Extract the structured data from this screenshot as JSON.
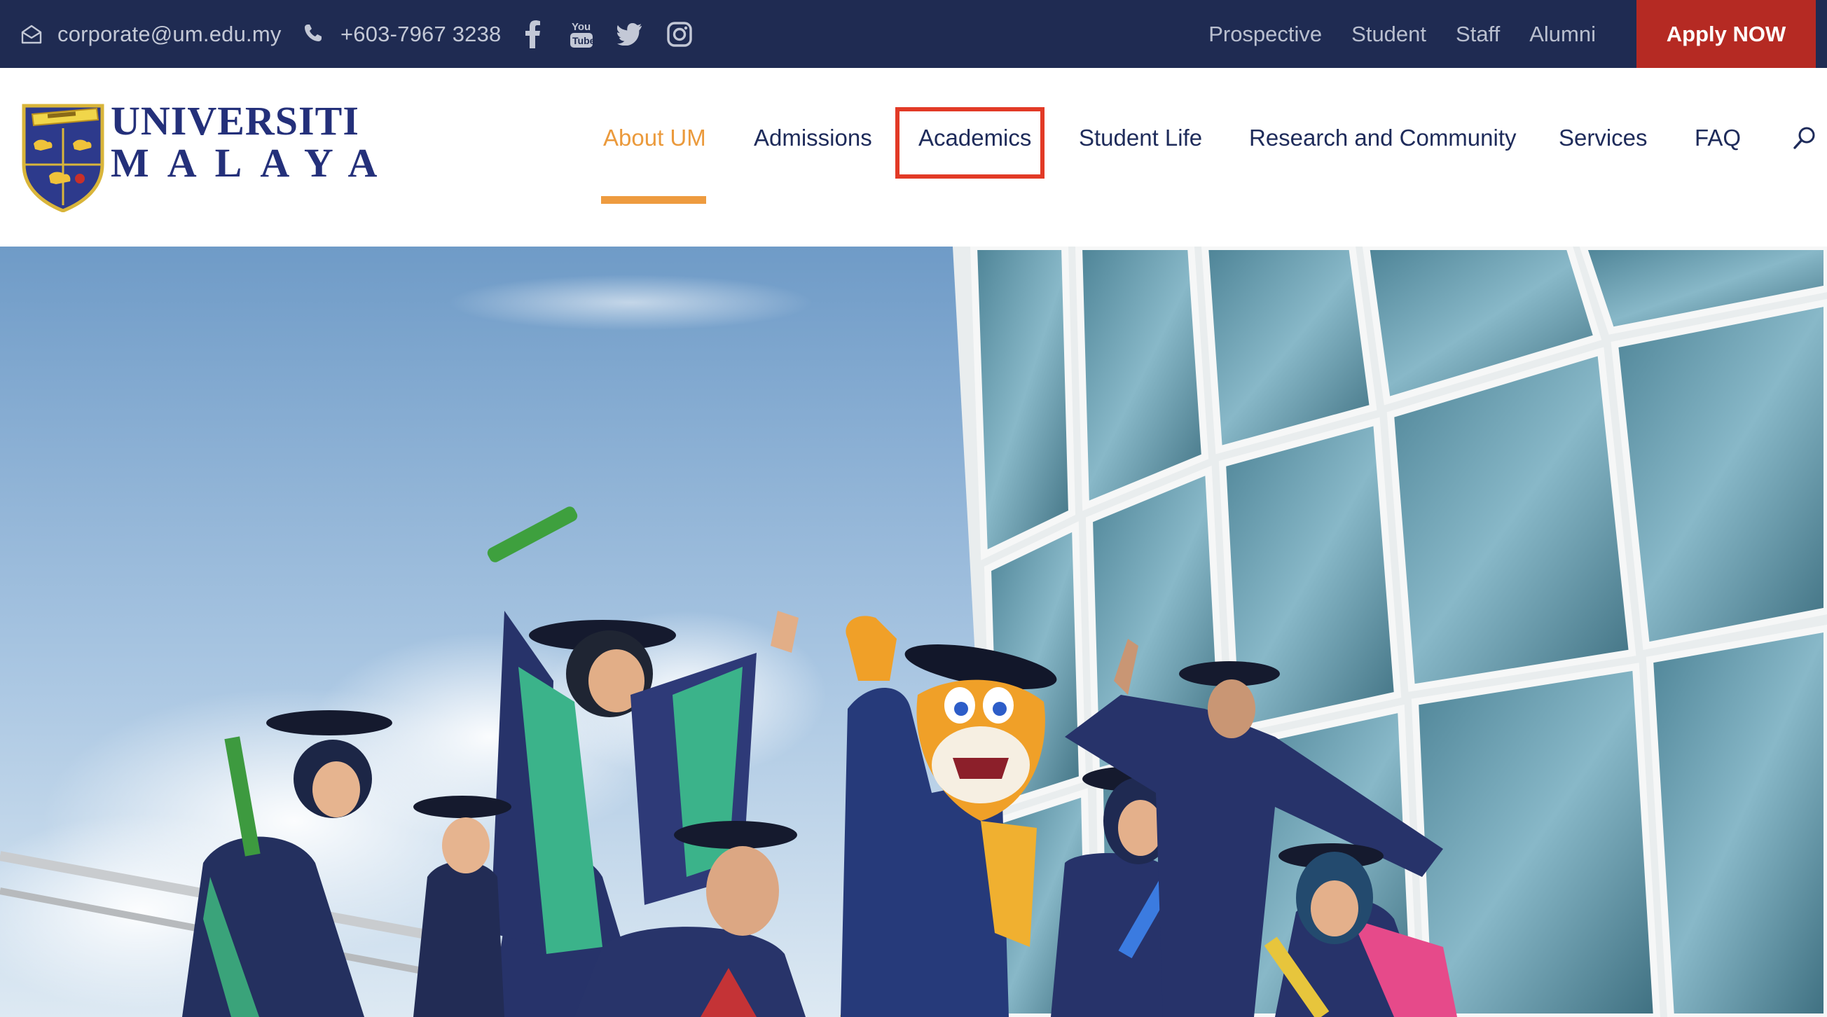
{
  "topbar": {
    "email": "corporate@um.edu.my",
    "phone": "+603-7967 3238",
    "social": [
      "facebook-icon",
      "youtube-icon",
      "twitter-icon",
      "instagram-icon"
    ],
    "links": [
      "Prospective",
      "Student",
      "Staff",
      "Alumni"
    ],
    "apply_label": "Apply NOW"
  },
  "logo": {
    "line1": "UNIVERSITI",
    "line2": "MALAYA"
  },
  "nav": {
    "items": [
      "About UM",
      "Admissions",
      "Academics",
      "Student Life",
      "Research and Community",
      "Services",
      "FAQ"
    ],
    "active": "About UM",
    "highlighted": "Academics"
  },
  "colors": {
    "topbar_bg": "#1f2b52",
    "apply_bg": "#b52a23",
    "nav_text": "#1e2b5a",
    "active": "#eb9a3c",
    "highlight_box": "#e23a26"
  }
}
